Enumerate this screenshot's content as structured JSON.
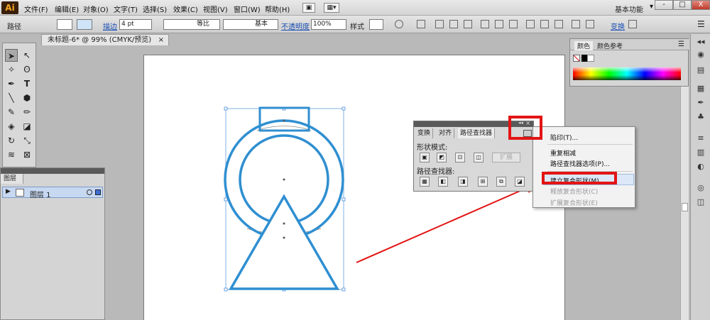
{
  "app": {
    "logo": "Ai"
  },
  "menubar": {
    "items": [
      "文件(F)",
      "编辑(E)",
      "对象(O)",
      "文字(T)",
      "选择(S)",
      "效果(C)",
      "视图(V)",
      "窗口(W)",
      "帮助(H)"
    ],
    "workspace": "基本功能",
    "window_buttons": [
      "-",
      "□",
      "X"
    ]
  },
  "controlbar": {
    "selection_label": "路径",
    "stroke_label": "描边",
    "stroke_weight": "4 pt",
    "profile_label": "等比",
    "brush_label": "基本",
    "opacity_label": "不透明度",
    "opacity_value": "100%",
    "style_label": "样式",
    "transform_label": "变换"
  },
  "document": {
    "tab_title": "未标题-6* @ 99% (CMYK/预览)"
  },
  "layers_panel": {
    "tab": "图层",
    "layer_name": "图层 1"
  },
  "pathfinder_panel": {
    "tabs": [
      "变换",
      "对齐",
      "路径查找器"
    ],
    "shape_modes_label": "形状模式:",
    "pathfinders_label": "路径查找器:",
    "expand_label": "扩展"
  },
  "flyout_menu": {
    "items": [
      {
        "label": "陷印(T)...",
        "enabled": true
      },
      {
        "label": "重复相减",
        "enabled": true
      },
      {
        "label": "路径查找器选项(P)...",
        "enabled": true
      },
      {
        "label": "建立复合形状(M)",
        "enabled": true,
        "highlighted": true
      },
      {
        "label": "释放复合形状(C)",
        "enabled": false
      },
      {
        "label": "扩展复合形状(E)",
        "enabled": false
      }
    ]
  },
  "color_panel": {
    "tabs": [
      "颜色",
      "颜色参考"
    ]
  },
  "colors": {
    "shape_stroke": "#2f8fd1",
    "annotation_red": "#e31414",
    "highlight": "#dce8f7"
  }
}
